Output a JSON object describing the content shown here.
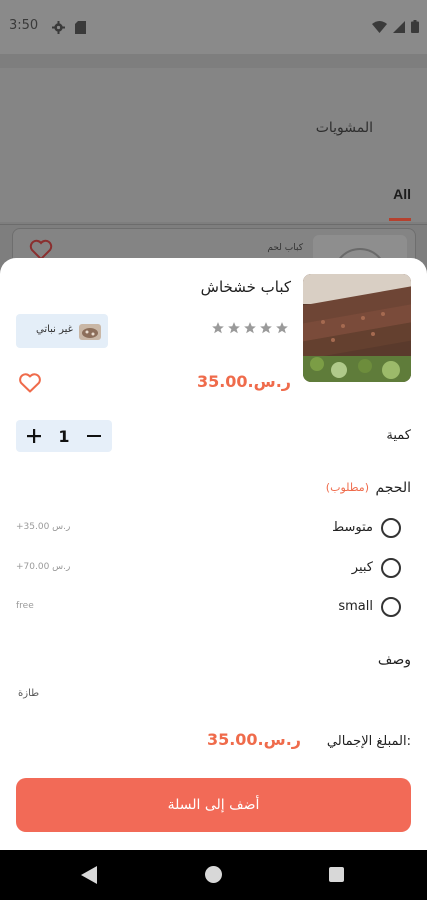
{
  "status_bar": {
    "time": "3:50"
  },
  "background": {
    "category_title": "المشويات",
    "tab_all": "All",
    "card_title": "كباب لحم"
  },
  "product": {
    "name": "كباب خشخاش",
    "price": "ر.س.35.00",
    "rating_stars": 5,
    "rating_filled": 0,
    "badge_label": "غير نباتي"
  },
  "quantity": {
    "label": "كمية",
    "value": "1"
  },
  "size": {
    "label": "الحجم",
    "required": "(مطلوب)",
    "options": [
      {
        "label": "متوسط",
        "price": "+35.00 ر.س"
      },
      {
        "label": "كبير",
        "price": "+70.00 ر.س"
      },
      {
        "label": "small",
        "price": "free"
      }
    ]
  },
  "description": {
    "label": "وصف",
    "text": "طازة"
  },
  "total": {
    "label": "المبلغ الإجمالي:",
    "value": "ر.س.35.00"
  },
  "cart_button": {
    "label": "أضف إلى السلة"
  },
  "colors": {
    "accent": "#ef6b4b",
    "button": "#f26a57",
    "badge_bg": "#e4eef8"
  },
  "icons": [
    "settings-icon",
    "sim-icon",
    "wifi-icon",
    "signal-icon",
    "battery-icon",
    "heart-icon",
    "star-icon",
    "plus-icon",
    "minus-icon",
    "non-veg-icon",
    "back-icon",
    "home-icon",
    "recents-icon"
  ]
}
